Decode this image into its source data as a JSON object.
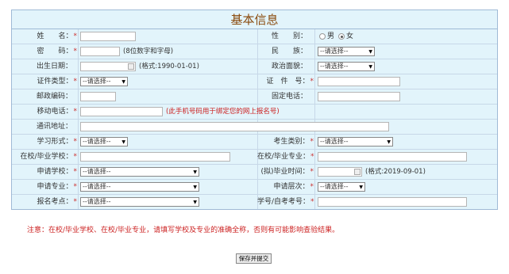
{
  "form": {
    "title": "基本信息",
    "required_mark": "*",
    "name_label": "姓　　名：",
    "gender_label": "性　　别：",
    "gender_male": "男",
    "gender_female": "女",
    "gender_selected": "女",
    "password_label": "密　　码：",
    "password_hint": "(8位数字和字母)",
    "ethnicity_label": "民　　族：",
    "select_placeholder": "--请选择--",
    "birth_label": "出生日期：",
    "birth_hint": "(格式:1990-01-01)",
    "political_label": "政治面貌：",
    "id_type_label": "证件类型：",
    "id_number_label": "证　件　号：",
    "postal_label": "邮政编码：",
    "phone_label": "固定电话：",
    "mobile_label": "移动电话：",
    "mobile_hint": "(此手机号码用于绑定您的网上报名号)",
    "address_label": "通讯地址：",
    "study_form_label": "学习形式：",
    "candidate_type_label": "考生类别：",
    "school_label": "在校/毕业学校：",
    "major_label": "在校/毕业专业：",
    "apply_school_label": "申请学校：",
    "grad_time_label": "(拟)毕业时间：",
    "grad_time_hint": "(格式:2019-09-01)",
    "apply_major_label": "申请专业：",
    "apply_level_label": "申请层次：",
    "exam_site_label": "报名考点：",
    "student_id_label": "学号/自考考号："
  },
  "notice": "注意：在校/毕业学校、在校/毕业专业，请填写学校及专业的准确全称，否则有可能影响查验结果。",
  "submit_label": "保存并提交",
  "colors": {
    "table_bg": "#e2f4fb",
    "border": "#9fbad6",
    "title": "#8a4a0c",
    "required": "#cc3333"
  }
}
